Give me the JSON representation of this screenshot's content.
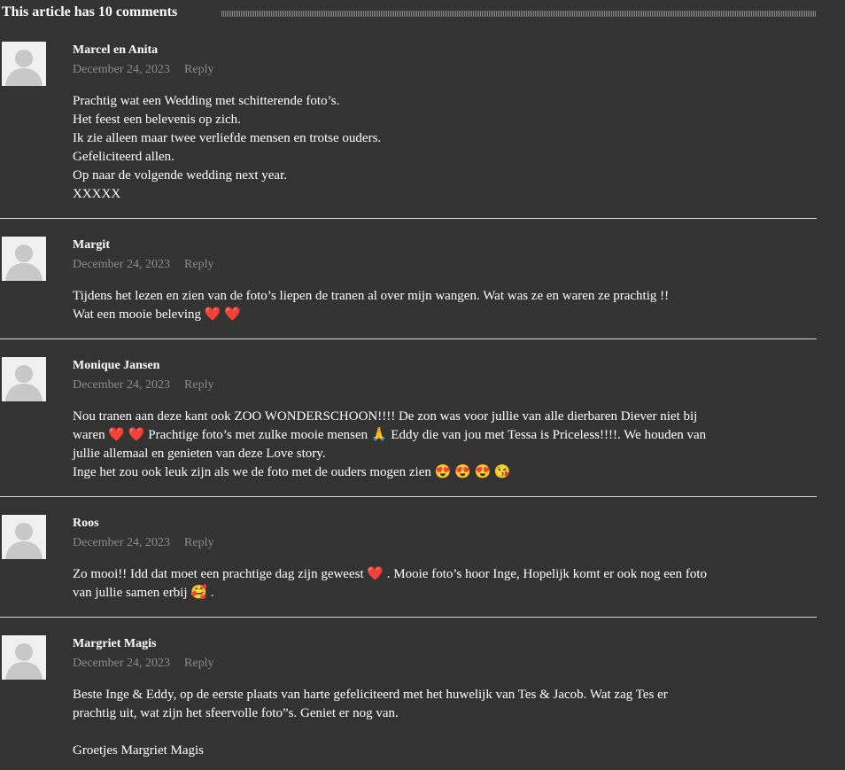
{
  "header": {
    "title": "This article has 10 comments"
  },
  "reply_label": "Reply",
  "comments": [
    {
      "author": "Marcel en Anita",
      "date": "December 24, 2023",
      "lines": [
        "Prachtig wat een Wedding met schitterende foto’s.",
        "Het feest een belevenis op zich.",
        "Ik zie alleen maar twee verliefde mensen en trotse ouders.",
        "Gefeliciteerd allen.",
        "Op naar de volgende wedding next year.",
        "XXXXX"
      ]
    },
    {
      "author": "Margit",
      "date": "December 24, 2023",
      "lines": [
        "Tijdens het lezen en zien van de foto’s liepen de tranen al over mijn wangen. Wat was ze en waren ze prachtig !!",
        "Wat een mooie beleving ❤️ ❤️"
      ]
    },
    {
      "author": "Monique Jansen",
      "date": "December 24, 2023",
      "lines": [
        "Nou tranen aan deze kant ook ZOO WONDERSCHOON!!!! De zon was voor jullie van alle dierbaren Diever niet bij",
        "waren ❤️ ❤️ Prachtige foto’s met zulke mooie mensen 🙏 Eddy die van jou met Tessa is Priceless!!!!. We houden van",
        "jullie allemaal en genieten van deze Love story.",
        "Inge het zou ook leuk zijn als we de foto met de ouders mogen zien 😍 😍 😍 😘"
      ]
    },
    {
      "author": "Roos",
      "date": "December 24, 2023",
      "lines": [
        "Zo mooi!! Idd dat moet een prachtige dag zijn geweest ❤️ . Mooie foto’s hoor Inge, Hopelijk komt er ook nog een foto",
        "van jullie samen erbij 🥰 ."
      ]
    },
    {
      "author": "Margriet Magis",
      "date": "December 24, 2023",
      "lines": [
        "Beste Inge & Eddy, op de eerste plaats van harte gefeliciteerd met het huwelijk van Tes & Jacob. Wat zag Tes er",
        "prachtig uit, wat zijn het sfeervolle foto”s. Geniet er nog van.",
        "",
        "Groetjes Margriet Magis"
      ]
    }
  ]
}
